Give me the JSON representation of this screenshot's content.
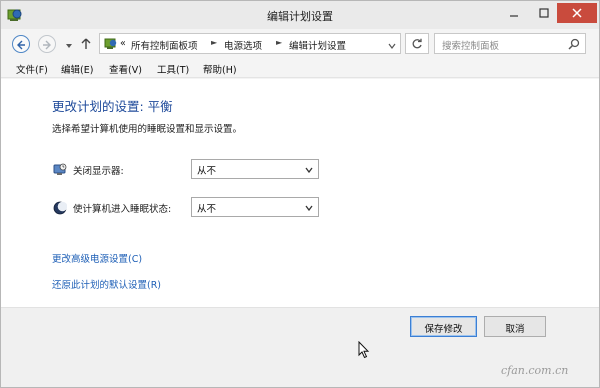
{
  "window": {
    "title": "编辑计划设置"
  },
  "nav": {
    "breadcrumbs": [
      "所有控制面板项",
      "电源选项",
      "编辑计划设置"
    ],
    "overflow_glyph": "«",
    "search_placeholder": "搜索控制面板"
  },
  "menu": {
    "items": [
      "文件(F)",
      "编辑(E)",
      "查看(V)",
      "工具(T)",
      "帮助(H)"
    ]
  },
  "main": {
    "heading": "更改计划的设置: 平衡",
    "subtitle": "选择希望计算机使用的睡眠设置和显示设置。",
    "settings": [
      {
        "label": "关闭显示器:",
        "value": "从不",
        "icon": "display-icon"
      },
      {
        "label": "使计算机进入睡眠状态:",
        "value": "从不",
        "icon": "sleep-moon-icon"
      }
    ],
    "links": [
      "更改高级电源设置(C)",
      "还原此计划的默认设置(R)"
    ]
  },
  "actions": {
    "save_label": "保存修改",
    "cancel_label": "取消"
  },
  "watermark": "cfan.com.cn",
  "colors": {
    "heading": "#1e4a9a",
    "link": "#1e5fb6",
    "close_button": "#c94b3d",
    "primary_button_border": "#3c7fd4"
  }
}
